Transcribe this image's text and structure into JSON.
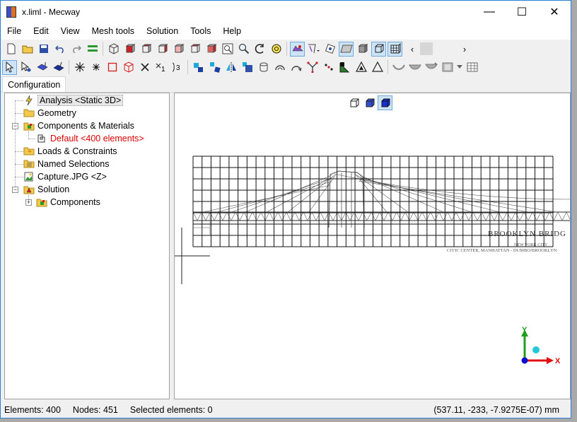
{
  "window": {
    "title": "x.liml - Mecway",
    "controls": {
      "minimize": "—",
      "maximize": "☐",
      "close": "✕"
    }
  },
  "menu": [
    "File",
    "Edit",
    "View",
    "Mesh tools",
    "Solution",
    "Tools",
    "Help"
  ],
  "tabs": [
    {
      "label": "Configuration",
      "active": true
    }
  ],
  "tree": {
    "items": [
      {
        "id": "analysis",
        "label": "Analysis <Static 3D>",
        "icon": "lightning-icon",
        "selected": true
      },
      {
        "id": "geometry",
        "label": "Geometry",
        "icon": "folder-icon"
      },
      {
        "id": "components",
        "label": "Components & Materials",
        "icon": "components-icon",
        "expanded": true
      },
      {
        "id": "default",
        "label": "Default <400 elements>",
        "icon": "component-part-icon",
        "color": "#e00000"
      },
      {
        "id": "loads",
        "label": "Loads & Constraints",
        "icon": "loads-folder-icon"
      },
      {
        "id": "named",
        "label": "Named Selections",
        "icon": "named-selections-icon"
      },
      {
        "id": "capture",
        "label": "Capture.JPG <Z>",
        "icon": "image-icon"
      },
      {
        "id": "solution",
        "label": "Solution",
        "icon": "solution-icon",
        "expanded": true
      },
      {
        "id": "sol-components",
        "label": "Components",
        "icon": "components-icon",
        "collapsed": true
      }
    ]
  },
  "viewport": {
    "background_image": {
      "title": "BROOKLYN BRIDG",
      "subtitle": "NEW YORK CITY",
      "caption": "CIVIC CENTER, MANHATTAN - DUMBO/BROOKLYN"
    },
    "mesh": {
      "columns": 40,
      "rows": 8
    },
    "axes": {
      "y_label": "Y",
      "x_label": "X"
    }
  },
  "status": {
    "elements": "Elements: 400",
    "nodes": "Nodes: 451",
    "selected": "Selected elements: 0",
    "coords": "(537.11, -233, -7.9275E-07) mm"
  },
  "colors": {
    "accent": "#2b7fd8",
    "red_text": "#e00000",
    "axis_y": "#1ea01e",
    "axis_x": "#e01010",
    "axis_origin": "#0a0ad0",
    "axis_z": "#22c8d8"
  }
}
